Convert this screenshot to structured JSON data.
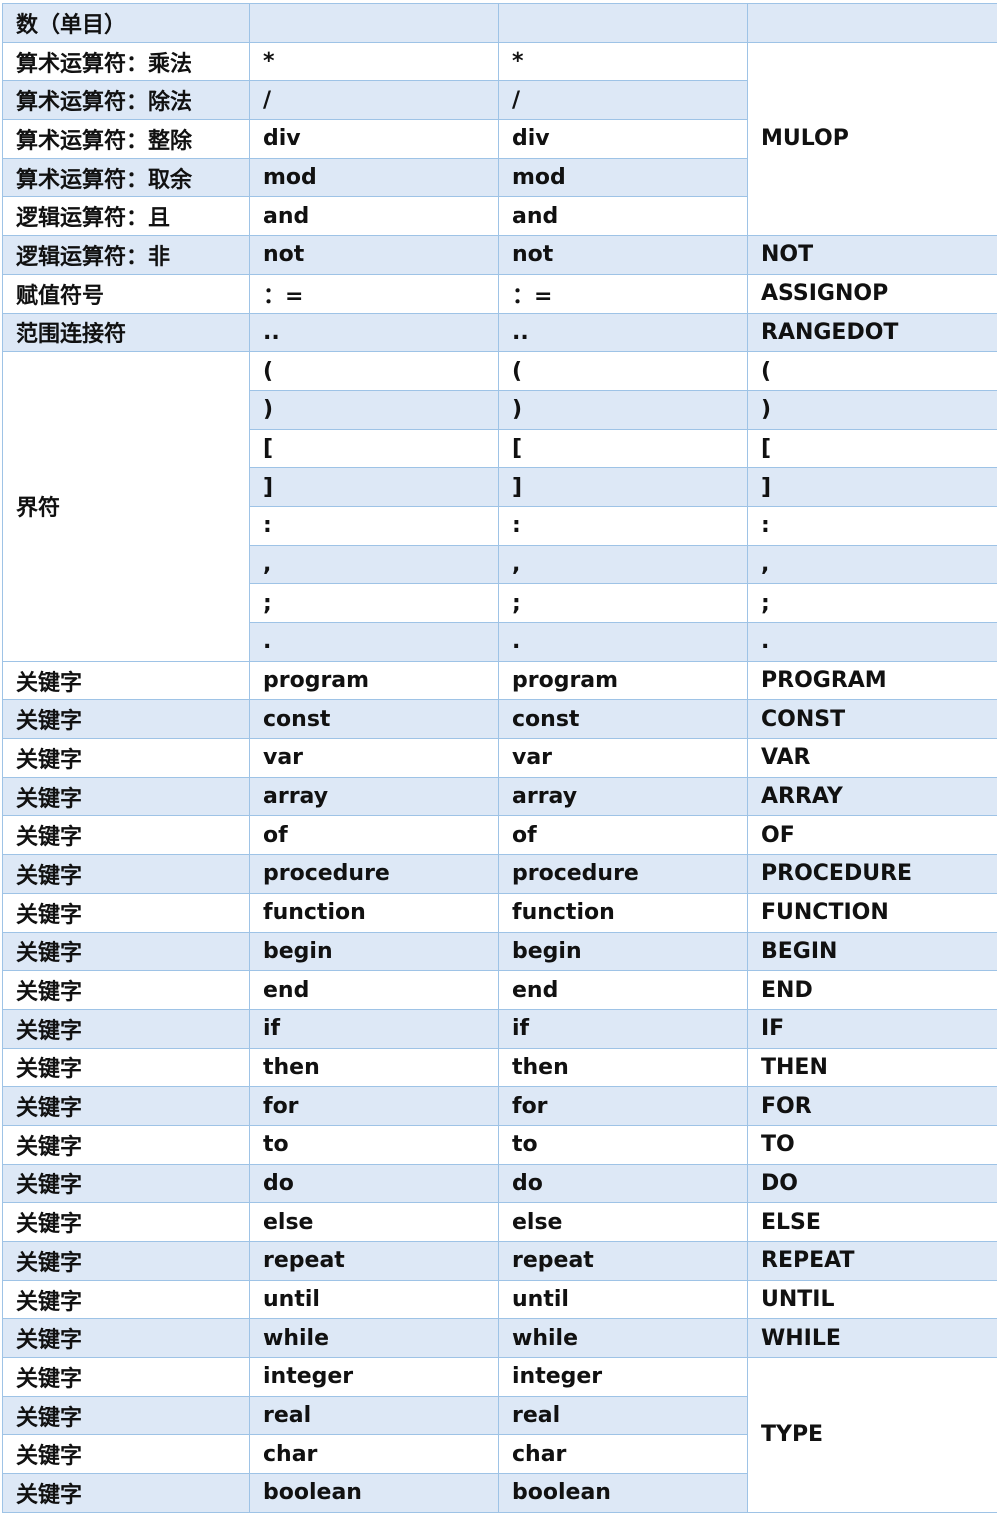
{
  "rows": [
    [
      "数（单目）",
      "",
      "",
      ""
    ],
    [
      "算术运算符：乘法",
      "*",
      "*",
      "MULOP"
    ],
    [
      "算术运算符：除法",
      "/",
      "/",
      ""
    ],
    [
      "算术运算符：整除",
      "div",
      "div",
      ""
    ],
    [
      "算术运算符：取余",
      "mod",
      "mod",
      ""
    ],
    [
      "逻辑运算符：且",
      "and",
      "and",
      ""
    ],
    [
      "逻辑运算符：非",
      "not",
      "not",
      "NOT"
    ],
    [
      "赋值符号",
      "：=",
      "：=",
      "ASSIGNOP"
    ],
    [
      "范围连接符",
      "..",
      "..",
      "RANGEDOT"
    ],
    [
      "界符",
      "(",
      "(",
      "("
    ],
    [
      "",
      ")",
      ")",
      ")"
    ],
    [
      "",
      "[",
      "[",
      "["
    ],
    [
      "",
      "]",
      "]",
      "]"
    ],
    [
      "",
      ":",
      ":",
      ":"
    ],
    [
      "",
      ",",
      ",",
      ","
    ],
    [
      "",
      ";",
      ";",
      ";"
    ],
    [
      "",
      ".",
      ".",
      "."
    ],
    [
      "关键字",
      "program",
      "program",
      "PROGRAM"
    ],
    [
      "关键字",
      "const",
      "const",
      "CONST"
    ],
    [
      "关键字",
      "var",
      "var",
      "VAR"
    ],
    [
      "关键字",
      "array",
      "array",
      "ARRAY"
    ],
    [
      "关键字",
      "of",
      "of",
      "OF"
    ],
    [
      "关键字",
      "procedure",
      "procedure",
      "PROCEDURE"
    ],
    [
      "关键字",
      "function",
      "function",
      "FUNCTION"
    ],
    [
      "关键字",
      "begin",
      "begin",
      "BEGIN"
    ],
    [
      "关键字",
      "end",
      "end",
      "END"
    ],
    [
      "关键字",
      "if",
      "if",
      "IF"
    ],
    [
      "关键字",
      "then",
      "then",
      "THEN"
    ],
    [
      "关键字",
      "for",
      "for",
      "FOR"
    ],
    [
      "关键字",
      "to",
      "to",
      "TO"
    ],
    [
      "关键字",
      "do",
      "do",
      "DO"
    ],
    [
      "关键字",
      "else",
      "else",
      "ELSE"
    ],
    [
      "关键字",
      "repeat",
      "repeat",
      "REPEAT"
    ],
    [
      "关键字",
      "until",
      "until",
      "UNTIL"
    ],
    [
      "关键字",
      "while",
      "while",
      "WHILE"
    ],
    [
      "关键字",
      "integer",
      "integer",
      "TYPE"
    ],
    [
      "关键字",
      "real",
      "real",
      ""
    ],
    [
      "关键字",
      "char",
      "char",
      ""
    ],
    [
      "关键字",
      "boolean",
      "boolean",
      ""
    ]
  ]
}
